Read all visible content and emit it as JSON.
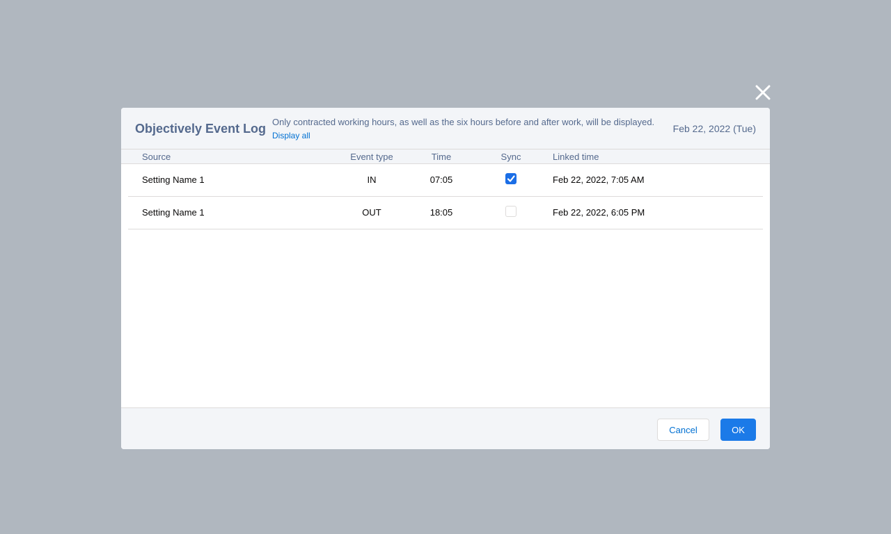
{
  "modal": {
    "title": "Objectively Event Log",
    "notice": "Only contracted working hours, as well as the six hours before and after work, will be displayed.",
    "display_all_link": "Display all",
    "date": "Feb 22, 2022 (Tue)",
    "close_icon": "close-icon"
  },
  "table": {
    "headers": {
      "source": "Source",
      "event_type": "Event type",
      "time": "Time",
      "sync": "Sync",
      "linked_time": "Linked time"
    },
    "rows": [
      {
        "source": "Setting Name 1",
        "event_type": "IN",
        "time": "07:05",
        "sync": true,
        "linked_time": "Feb 22, 2022, 7:05 AM"
      },
      {
        "source": "Setting Name 1",
        "event_type": "OUT",
        "time": "18:05",
        "sync": false,
        "linked_time": "Feb 22, 2022, 6:05 PM"
      }
    ]
  },
  "footer": {
    "cancel_label": "Cancel",
    "ok_label": "OK"
  },
  "colors": {
    "overlay": "#b0b7bf",
    "accent": "#1b7ae8",
    "link": "#0070d2",
    "header_bg": "#f3f5f8"
  }
}
